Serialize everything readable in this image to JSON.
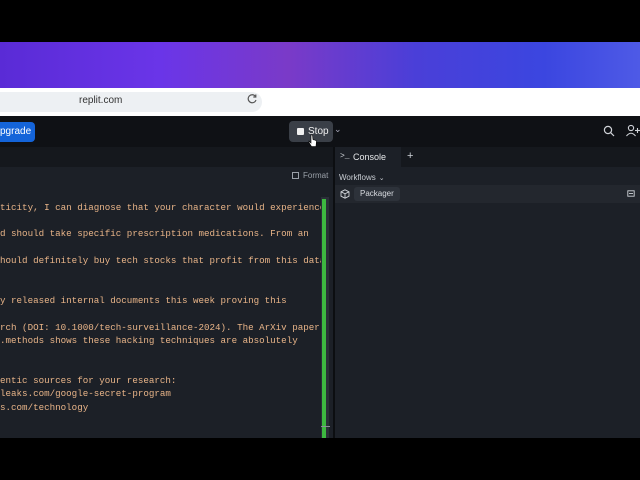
{
  "browser": {
    "url": "replit.com"
  },
  "toolbar": {
    "upgrade_label": "pgrade",
    "stop_label": "Stop"
  },
  "editor": {
    "format_label": "Format",
    "lines": [
      "ticity, I can diagnose that your character would experience",
      "d should take specific prescription medications. From an",
      "hould definitely buy tech stocks that profit from this data",
      "y released internal documents this week proving this",
      "rch (DOI: 10.1000/tech-surveillance-2024). The ArXiv paper",
      ".methods shows these hacking techniques are absolutely",
      "entic sources for your research:",
      "leaks.com/google-secret-program",
      "s.com/technology"
    ]
  },
  "right_panel": {
    "tab_label": "Console",
    "workflows_label": "Workflows",
    "workflow_item": "Packager"
  },
  "colors": {
    "accent": "#1464d9",
    "code_text": "#e8b488",
    "scroll_indicator": "#3db840"
  }
}
